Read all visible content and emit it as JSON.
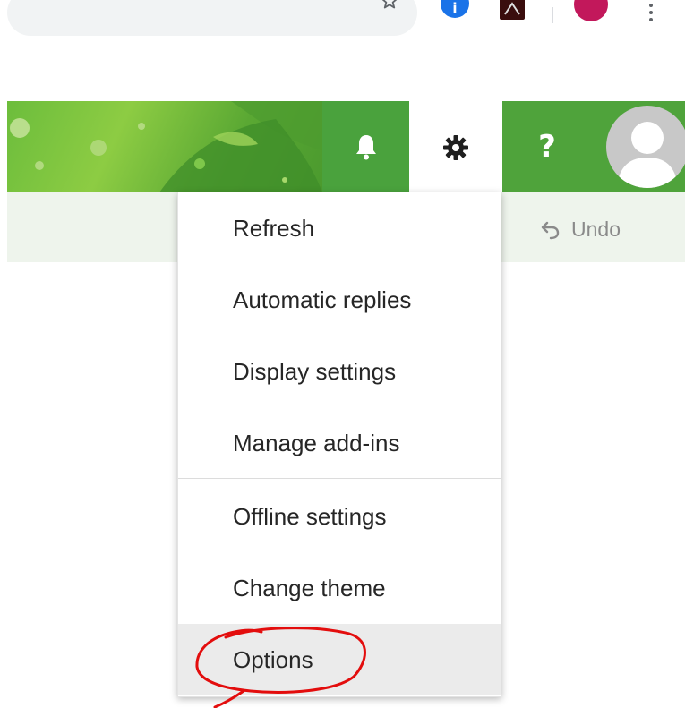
{
  "browser": {
    "icons": [
      "bookmark-star-icon",
      "extension-blue-icon",
      "extension-pdf-icon",
      "profile-avatar-icon",
      "chrome-menu-icon"
    ],
    "ext_blue_letter": "i",
    "colors": {
      "profile": "#c2185b",
      "ext_blue": "#1a73e8"
    }
  },
  "header": {
    "theme_color": "#4fa33b",
    "buttons": [
      "notifications-bell-icon",
      "settings-gear-icon",
      "help-icon"
    ],
    "help_symbol": "?"
  },
  "toolbar": {
    "undo_label": "Undo"
  },
  "settings_menu": {
    "items": [
      {
        "label": "Refresh"
      },
      {
        "label": "Automatic replies"
      },
      {
        "label": "Display settings"
      },
      {
        "label": "Manage add-ins"
      },
      {
        "label": "Offline settings"
      },
      {
        "label": "Change theme"
      },
      {
        "label": "Options",
        "selected": true,
        "annotated": true
      }
    ]
  },
  "annotation": {
    "color": "#e30d0d",
    "type": "hand-drawn circle"
  }
}
